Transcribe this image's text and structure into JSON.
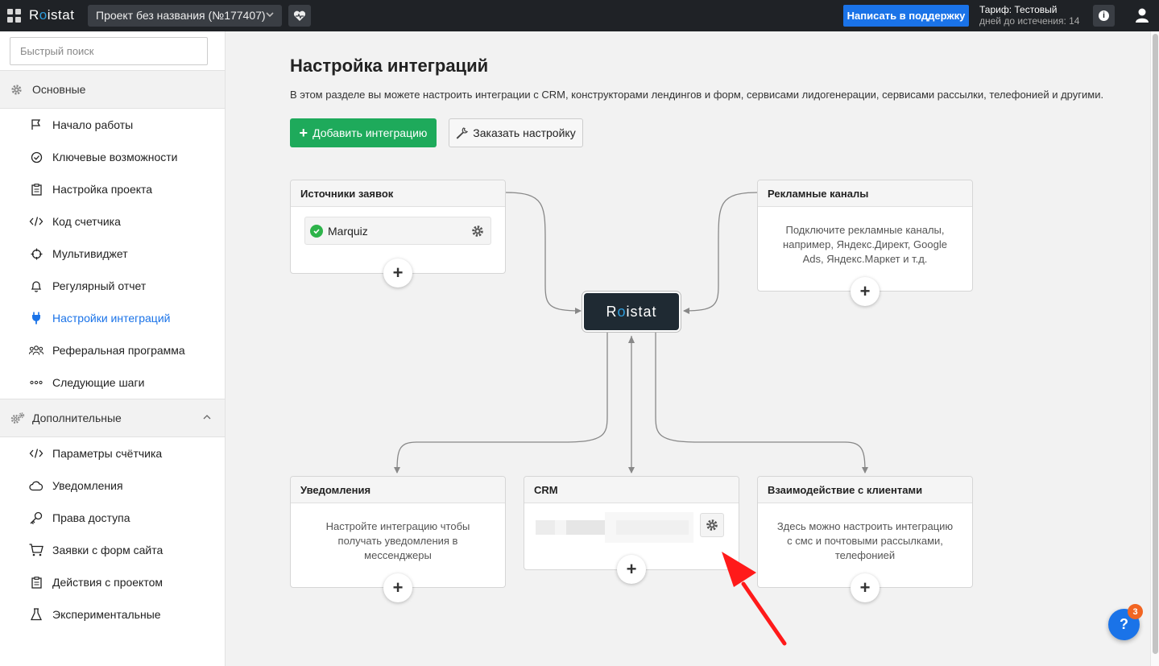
{
  "topbar": {
    "logo_pre": "R",
    "logo_o": "o",
    "logo_post": "istat",
    "project_name": "Проект без названия (№177407)",
    "support_label": "Написать в поддержку",
    "tariff_label": "Тариф: Тестовый",
    "tariff_days": "дней до истечения: 14"
  },
  "sidebar": {
    "search_placeholder": "Быстрый поиск",
    "section_main": "Основные",
    "main_items": [
      {
        "label": "Начало работы",
        "icon": "flag-icon"
      },
      {
        "label": "Ключевые возможности",
        "icon": "check-circle-icon"
      },
      {
        "label": "Настройка проекта",
        "icon": "clipboard-icon"
      },
      {
        "label": "Код счетчика",
        "icon": "code-icon"
      },
      {
        "label": "Мультивиджет",
        "icon": "crosshair-icon"
      },
      {
        "label": "Регулярный отчет",
        "icon": "bell-icon"
      },
      {
        "label": "Настройки интеграций",
        "icon": "plug-icon"
      },
      {
        "label": "Реферальная программа",
        "icon": "users-icon"
      },
      {
        "label": "Следующие шаги",
        "icon": "dots-icon"
      }
    ],
    "section_extra": "Дополнительные",
    "extra_items": [
      {
        "label": "Параметры счётчика",
        "icon": "code-icon"
      },
      {
        "label": "Уведомления",
        "icon": "cloud-icon"
      },
      {
        "label": "Права доступа",
        "icon": "key-icon"
      },
      {
        "label": "Заявки с форм сайта",
        "icon": "cart-icon"
      },
      {
        "label": "Действия с проектом",
        "icon": "clipboard-icon"
      },
      {
        "label": "Экспериментальные",
        "icon": "flask-icon"
      }
    ],
    "active_item": "Настройки интеграций"
  },
  "main": {
    "title": "Настройка интеграций",
    "description": "В этом разделе вы можете настроить интеграции с CRM, конструкторами лендингов и форм, сервисами лидогенерации, сервисами рассылки, телефонией и другими.",
    "add_button": "Добавить интеграцию",
    "order_button": "Заказать настройку",
    "center_node": {
      "pre": "R",
      "o": "o",
      "post": "istat"
    },
    "cards": {
      "sources": {
        "title": "Источники заявок",
        "item": "Marquiz"
      },
      "ads": {
        "title": "Рекламные каналы",
        "text": "Подключите рекламные каналы, например, Яндекс.Директ, Google Ads, Яндекс.Маркет и т.д."
      },
      "notifications": {
        "title": "Уведомления",
        "text": "Настройте интеграцию чтобы получать уведомления в мессенджеры"
      },
      "crm": {
        "title": "CRM"
      },
      "clients": {
        "title": "Взаимодействие с клиентами",
        "text": "Здесь можно настроить интеграцию с смс и почтовыми рассылками, телефонией"
      }
    },
    "plus": "+"
  },
  "help": {
    "label": "?",
    "badge": "3"
  },
  "colors": {
    "topbar_bg": "#1f2226",
    "primary": "#1a73e8",
    "success": "#1eaa5b",
    "node_bg": "#1f2a33",
    "arrow": "#ff1a1a"
  }
}
